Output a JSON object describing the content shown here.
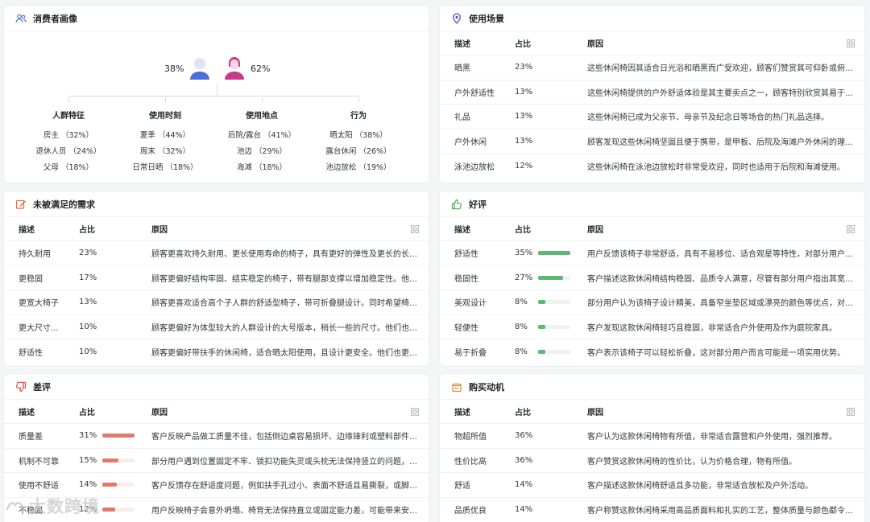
{
  "persona": {
    "title": "消费者画像",
    "male_pct": "38%",
    "female_pct": "62%",
    "columns": [
      {
        "title": "人群特征",
        "items": [
          "房主 （32%）",
          "退休人员 （24%）",
          "父母 （18%）"
        ]
      },
      {
        "title": "使用时刻",
        "items": [
          "夏季 （44%）",
          "周末 （32%）",
          "日常日晒 （18%）"
        ]
      },
      {
        "title": "使用地点",
        "items": [
          "后院/露台 （41%）",
          "池边 （29%）",
          "海滩 （18%）"
        ]
      },
      {
        "title": "行为",
        "items": [
          "晒太阳 （38%）",
          "露台休闲 （26%）",
          "池边放松 （19%）"
        ]
      }
    ]
  },
  "scenes": {
    "title": "使用场景",
    "headers": [
      "描述",
      "占比",
      "原因"
    ],
    "rows": [
      {
        "desc": "晒黑",
        "pct": "23%",
        "reason": "这些休闲椅因其适合日光浴和晒黑而广受欢迎，顾客们赞赏其可仰卧或俯卧..."
      },
      {
        "desc": "户外舒适性",
        "pct": "13%",
        "reason": "这些休闲椅提供的户外舒适体验是其主要卖点之一，顾客特别欣赏其易于清..."
      },
      {
        "desc": "礼品",
        "pct": "13%",
        "reason": "这些休闲椅已成为父亲节、母亲节及纪念日等场合的热门礼品选择。"
      },
      {
        "desc": "户外休闲",
        "pct": "13%",
        "reason": "顾客发现这些休闲椅坚固且便于携带，是甲板、后院及海滩户外休闲的理想..."
      },
      {
        "desc": "泳池边放松",
        "pct": "12%",
        "reason": "这些休闲椅在泳池边放松时非常受欢迎，同时也适用于后院和海滩使用。"
      }
    ]
  },
  "unmet": {
    "title": "未被满足的需求",
    "headers": [
      "描述",
      "占比",
      "原因"
    ],
    "rows": [
      {
        "desc": "持久耐用",
        "pct": "23%",
        "reason": "顾客更喜欢持久耐用、更长使用寿命的椅子，具有更好的弹性及更长的长度。"
      },
      {
        "desc": "更稳固",
        "pct": "17%",
        "reason": "顾客更偏好结构牢固、结实稳定的椅子，带有腿部支撑以增加稳定性。他们..."
      },
      {
        "desc": "更宽大椅子",
        "pct": "13%",
        "reason": "顾客更喜欢适合高个子人群的舒适型椅子，带可折叠腿设计。同时希望椅子..."
      },
      {
        "desc": "更大尺寸...",
        "pct": "10%",
        "reason": "顾客更偏好为体型较大的人群设计的大号版本，稍长一些的尺寸。他们也更..."
      },
      {
        "desc": "舒适性",
        "pct": "10%",
        "reason": "顾客更偏好带扶手的休闲椅，适合晒太阳使用，且设计更安全。他们也更喜..."
      }
    ]
  },
  "positive": {
    "title": "好评",
    "headers": [
      "描述",
      "占比",
      "原因"
    ],
    "bar_color": "#5cb874",
    "bar_bg": "#eaf6ed",
    "rows": [
      {
        "desc": "舒适性",
        "pct": "35%",
        "value": 35,
        "reason": "用户反馈该椅子非常舒适，具有不易移位、适合观星等特性，对部分用户而..."
      },
      {
        "desc": "稳固性",
        "pct": "27%",
        "value": 27,
        "reason": "客户描述这款休闲椅结构稳固、品质令人满意，尽管有部分用户指出其宽度..."
      },
      {
        "desc": "美观设计",
        "pct": "8%",
        "value": 8,
        "reason": "部分用户认为该椅子设计精美，具备窄坐垫区域或漂亮的颜色等优点，对某..."
      },
      {
        "desc": "轻便性",
        "pct": "8%",
        "value": 8,
        "reason": "客户发现这款休闲椅轻巧且稳固，非常适合户外使用及作为庭院家具。"
      },
      {
        "desc": "易于折叠",
        "pct": "8%",
        "value": 8,
        "reason": "客户表示该椅子可以轻松折叠，这对部分用户而言可能是一项实用优势。"
      }
    ]
  },
  "negative": {
    "title": "差评",
    "headers": [
      "描述",
      "占比",
      "原因"
    ],
    "bar_color": "#e0796a",
    "bar_bg": "#fbecea",
    "rows": [
      {
        "desc": "质量差",
        "pct": "31%",
        "value": 31,
        "reason": "客户反映产品做工质量不佳，包括侧边桌容易损坏、边缘锋利或塑料部件廉..."
      },
      {
        "desc": "机制不可靠",
        "pct": "15%",
        "value": 15,
        "reason": "部分用户遇到位置固定不牢、锁扣功能失灵或头枕无法保持竖立的问题，可..."
      },
      {
        "desc": "使用不舒适",
        "pct": "14%",
        "value": 14,
        "reason": "客户反馈存在舒适度问题，例如扶手孔过小、表面不舒适且易撕裂，或脚踏..."
      },
      {
        "desc": "不稳固",
        "pct": "12%",
        "value": 12,
        "reason": "用户反映椅子会意外坍塌、椅背无法保持直立或固定能力差，可能带来安全..."
      }
    ]
  },
  "motivation": {
    "title": "购买动机",
    "headers": [
      "描述",
      "占比",
      "原因"
    ],
    "rows": [
      {
        "desc": "物超所值",
        "pct": "36%",
        "reason": "客户认为这款休闲椅物有所值，非常适合露营和户外使用，强烈推荐。"
      },
      {
        "desc": "性价比高",
        "pct": "36%",
        "reason": "客户赞赏这款休闲椅的性价比，认为价格合理，物有所值。"
      },
      {
        "desc": "舒适",
        "pct": "14%",
        "reason": "客户描述这款休闲椅舒适且多功能，非常适合放松及户外活动。"
      },
      {
        "desc": "品质优良",
        "pct": "14%",
        "reason": "客户称赞这款休闲椅采用高品质面料和扎实的工艺，整体质量与颜色都令人..."
      }
    ]
  },
  "watermark": "大数跨境",
  "colors": {
    "male": "#4a6fd8",
    "female": "#c93a8b",
    "accent_blue": "#4a6fd8"
  }
}
